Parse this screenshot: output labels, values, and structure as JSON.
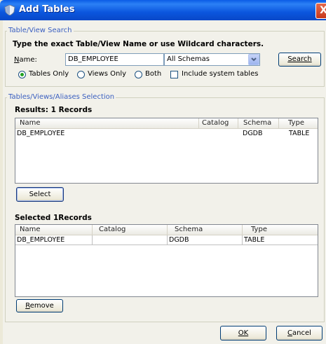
{
  "window": {
    "title": "Add Tables",
    "close_glyph": "X"
  },
  "search_group": {
    "title": "Table/View Search",
    "instruction": "Type the exact Table/View Name or use Wildcard characters.",
    "name_label": "Name:",
    "name_value": "DB_EMPLOYEE",
    "schema_selected": "All Schemas",
    "search_button": "Search",
    "options": [
      {
        "label": "Tables Only",
        "selected": true
      },
      {
        "label": "Views Only",
        "selected": false
      },
      {
        "label": "Both",
        "selected": false
      }
    ],
    "include_system": {
      "label": "Include system tables",
      "checked": false
    }
  },
  "selection_group": {
    "title": "Tables/Views/Aliases Selection",
    "results_heading": "Results: 1 Records",
    "results": {
      "columns": [
        "Name",
        "Catalog",
        "Schema",
        "Type"
      ],
      "rows": [
        {
          "name": "DB_EMPLOYEE",
          "catalog": "",
          "schema": "DGDB",
          "type": "TABLE"
        }
      ]
    },
    "select_button": "Select",
    "selected_heading": "Selected 1Records",
    "selected": {
      "columns": [
        "Name",
        "Catalog",
        "Schema",
        "Type"
      ],
      "rows": [
        {
          "name": "DB_EMPLOYEE",
          "catalog": "",
          "schema": "DGDB",
          "type": "TABLE"
        }
      ]
    },
    "remove_button": "Remove"
  },
  "footer": {
    "ok_button": "OK",
    "cancel_button": "Cancel"
  },
  "colors": {
    "title_bar": "#0a5ce6",
    "group_title": "#3a5fc0",
    "radio_on": "#21a121"
  },
  "icons": {
    "app": "shield-icon",
    "close": "close-icon",
    "dropdown": "chevron-down-icon"
  }
}
